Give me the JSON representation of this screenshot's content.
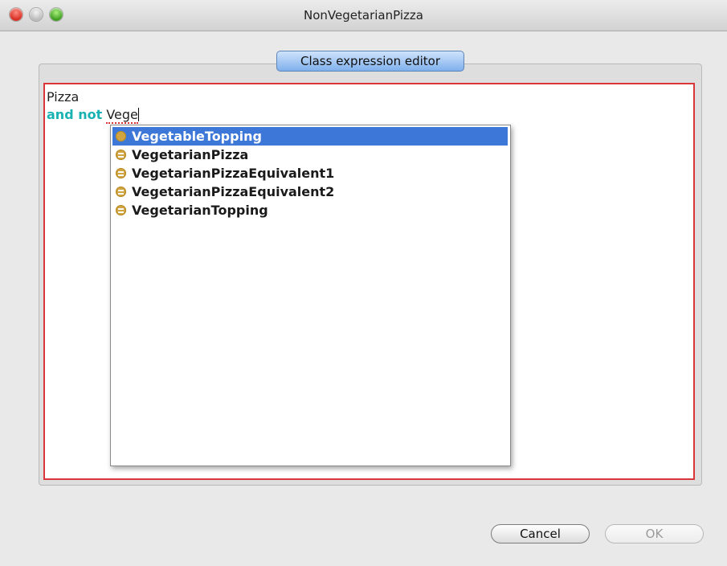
{
  "window": {
    "title": "NonVegetarianPizza"
  },
  "tab": {
    "label": "Class expression editor"
  },
  "editor": {
    "line1": "Pizza",
    "keyword": "and not",
    "typed": "Vege"
  },
  "autocomplete": {
    "items": [
      {
        "label": "VegetableTopping",
        "icon": "class-icon",
        "selected": true
      },
      {
        "label": "VegetarianPizza",
        "icon": "defined-class-icon",
        "selected": false
      },
      {
        "label": "VegetarianPizzaEquivalent1",
        "icon": "defined-class-icon",
        "selected": false
      },
      {
        "label": "VegetarianPizzaEquivalent2",
        "icon": "defined-class-icon",
        "selected": false
      },
      {
        "label": "VegetarianTopping",
        "icon": "defined-class-icon",
        "selected": false
      }
    ]
  },
  "buttons": {
    "cancel": "Cancel",
    "ok": "OK"
  }
}
